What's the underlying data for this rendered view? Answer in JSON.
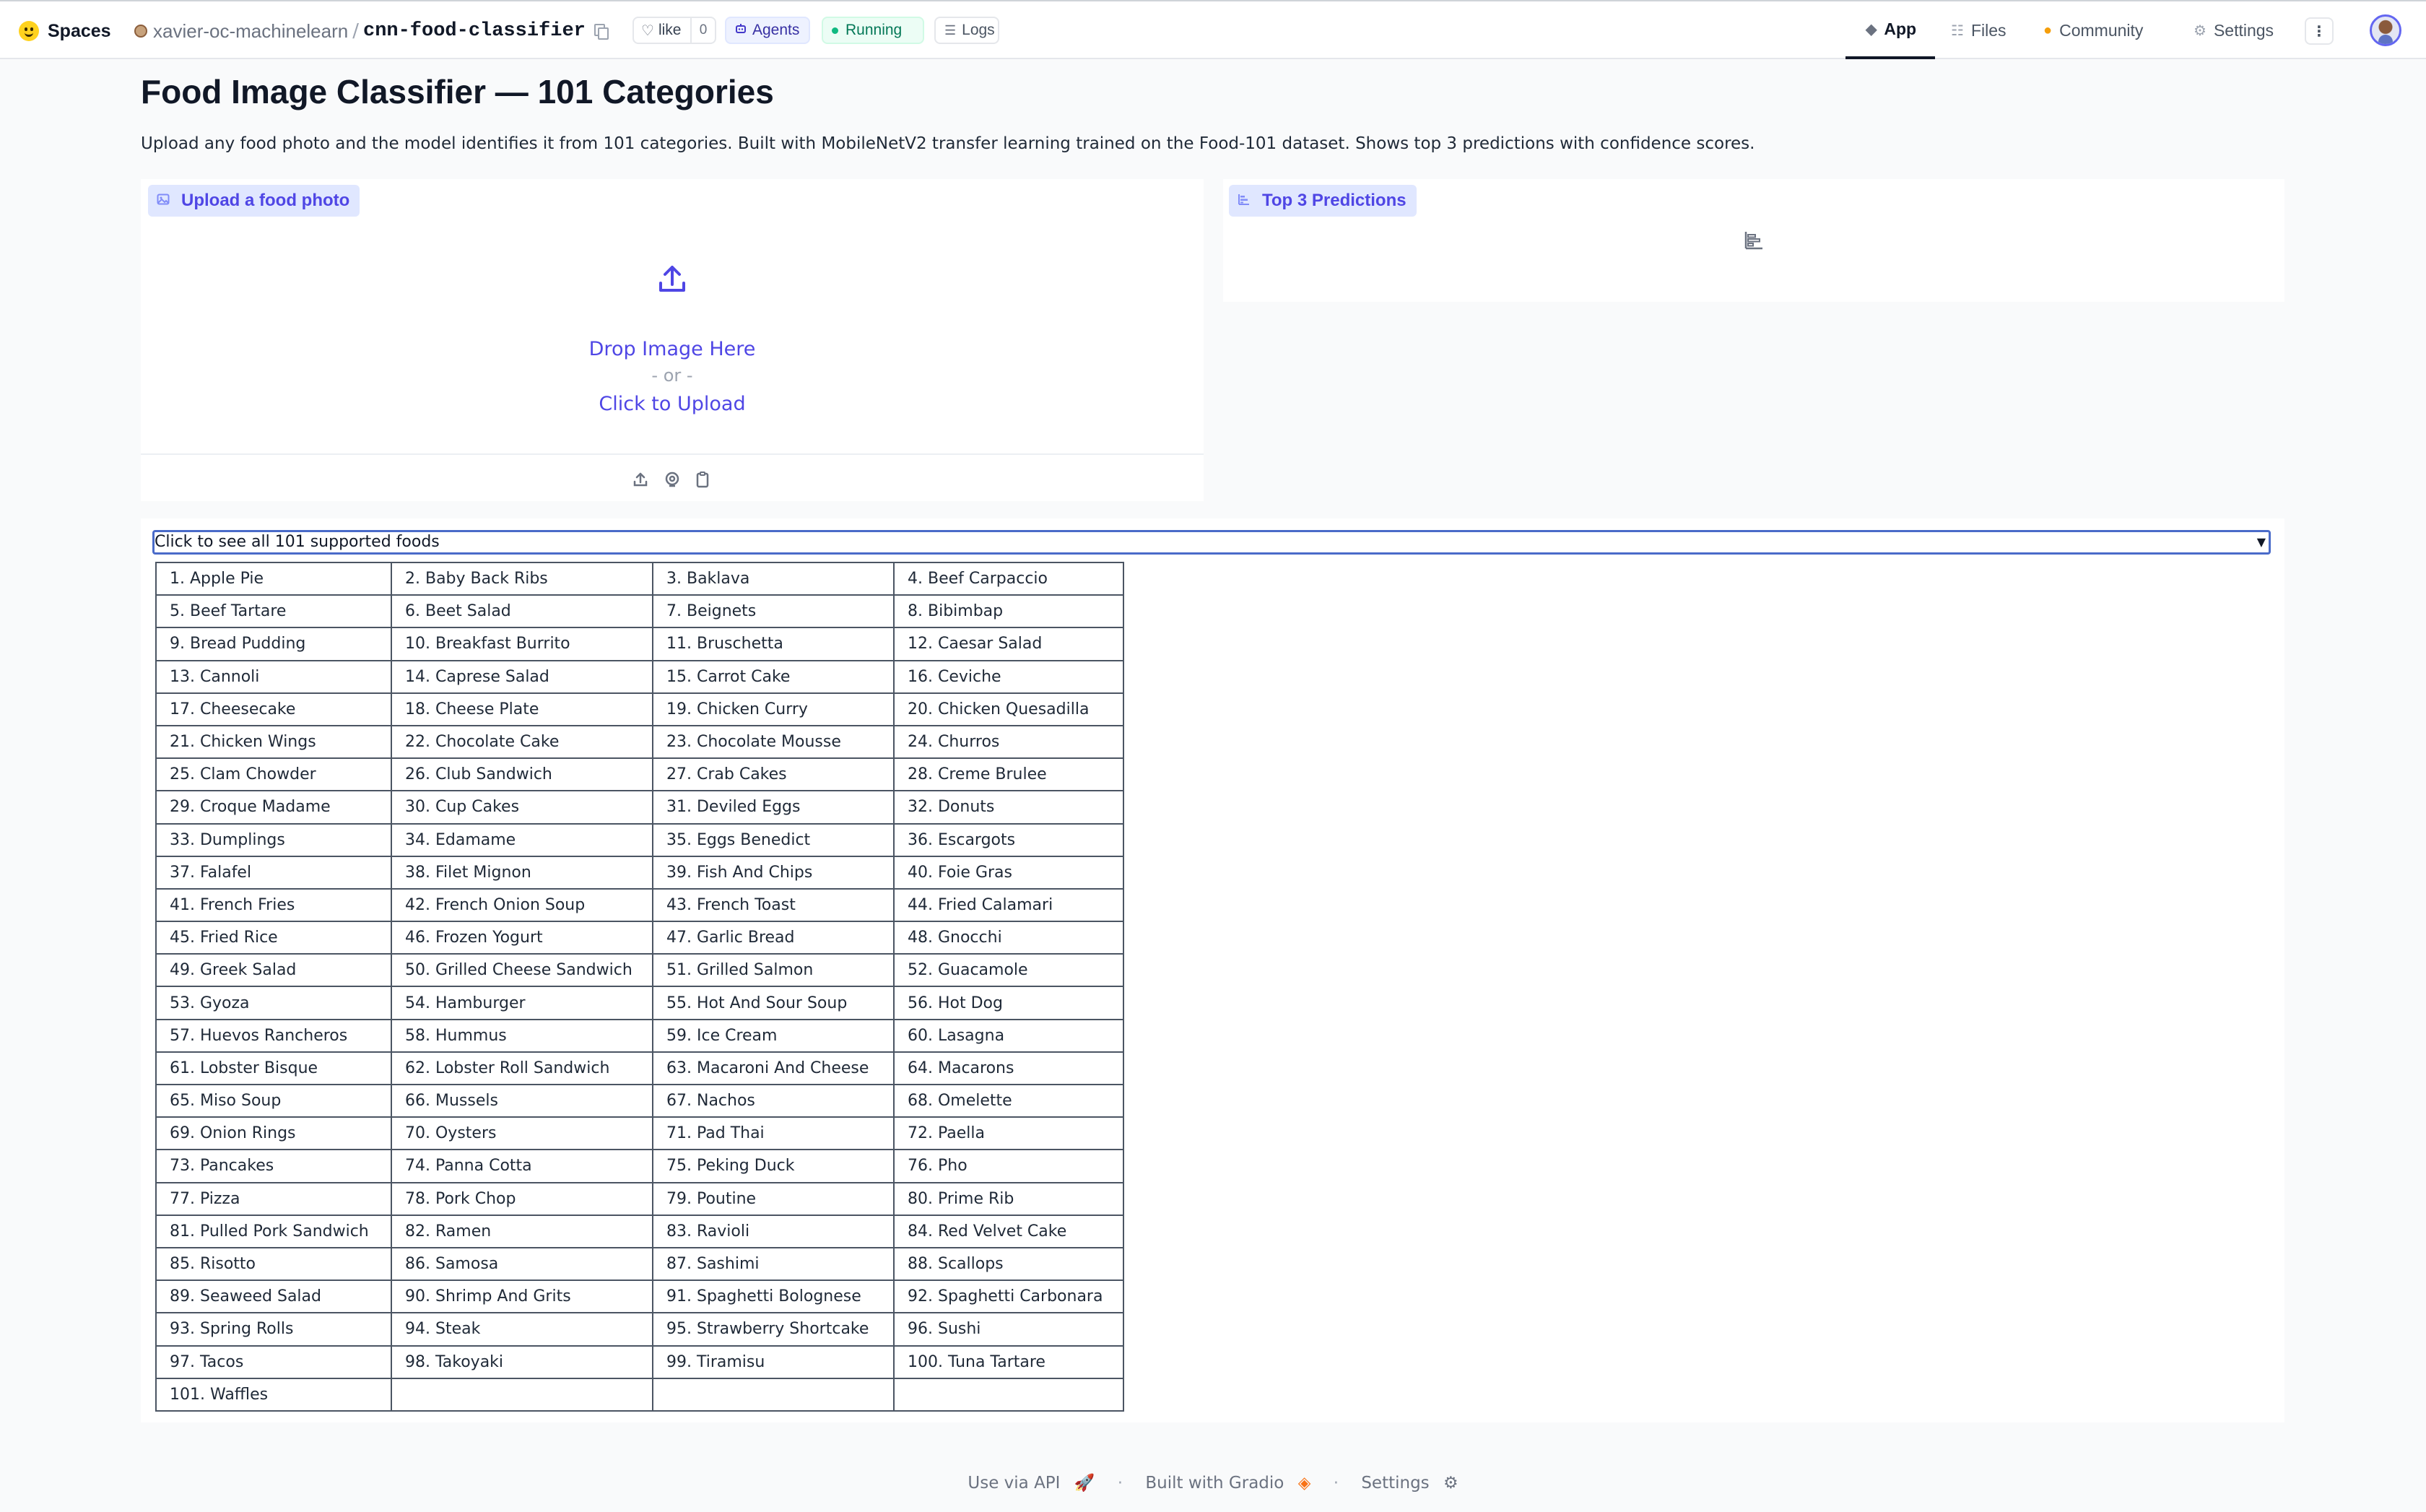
{
  "header": {
    "brand": "Spaces",
    "owner": "xavier-oc-machinelearn",
    "repo_name": "cnn-food-classifier",
    "like_label": "like",
    "like_count": "0",
    "agents_label": "Agents",
    "status_label": "Running",
    "logs_label": "Logs",
    "nav": {
      "app": "App",
      "files": "Files",
      "community": "Community",
      "settings": "Settings"
    }
  },
  "main": {
    "title": "Food Image Classifier — 101 Categories",
    "description": "Upload any food photo and the model identifies it from 101 categories. Built with MobileNetV2 transfer learning trained on the Food-101 dataset. Shows top 3 predictions with confidence scores.",
    "upload": {
      "label": "Upload a food photo",
      "drop_text": "Drop Image Here",
      "or_text": "- or -",
      "click_text": "Click to Upload"
    },
    "predictions": {
      "label": "Top 3 Predictions"
    },
    "foods_summary": "Click to see all 101 supported foods",
    "foods_rows": [
      [
        "1. Apple Pie",
        "2. Baby Back Ribs",
        "3. Baklava",
        "4. Beef Carpaccio"
      ],
      [
        "5. Beef Tartare",
        "6. Beet Salad",
        "7. Beignets",
        "8. Bibimbap"
      ],
      [
        "9. Bread Pudding",
        "10. Breakfast Burrito",
        "11. Bruschetta",
        "12. Caesar Salad"
      ],
      [
        "13. Cannoli",
        "14. Caprese Salad",
        "15. Carrot Cake",
        "16. Ceviche"
      ],
      [
        "17. Cheesecake",
        "18. Cheese Plate",
        "19. Chicken Curry",
        "20. Chicken Quesadilla"
      ],
      [
        "21. Chicken Wings",
        "22. Chocolate Cake",
        "23. Chocolate Mousse",
        "24. Churros"
      ],
      [
        "25. Clam Chowder",
        "26. Club Sandwich",
        "27. Crab Cakes",
        "28. Creme Brulee"
      ],
      [
        "29. Croque Madame",
        "30. Cup Cakes",
        "31. Deviled Eggs",
        "32. Donuts"
      ],
      [
        "33. Dumplings",
        "34. Edamame",
        "35. Eggs Benedict",
        "36. Escargots"
      ],
      [
        "37. Falafel",
        "38. Filet Mignon",
        "39. Fish And Chips",
        "40. Foie Gras"
      ],
      [
        "41. French Fries",
        "42. French Onion Soup",
        "43. French Toast",
        "44. Fried Calamari"
      ],
      [
        "45. Fried Rice",
        "46. Frozen Yogurt",
        "47. Garlic Bread",
        "48. Gnocchi"
      ],
      [
        "49. Greek Salad",
        "50. Grilled Cheese Sandwich",
        "51. Grilled Salmon",
        "52. Guacamole"
      ],
      [
        "53. Gyoza",
        "54. Hamburger",
        "55. Hot And Sour Soup",
        "56. Hot Dog"
      ],
      [
        "57. Huevos Rancheros",
        "58. Hummus",
        "59. Ice Cream",
        "60. Lasagna"
      ],
      [
        "61. Lobster Bisque",
        "62. Lobster Roll Sandwich",
        "63. Macaroni And Cheese",
        "64. Macarons"
      ],
      [
        "65. Miso Soup",
        "66. Mussels",
        "67. Nachos",
        "68. Omelette"
      ],
      [
        "69. Onion Rings",
        "70. Oysters",
        "71. Pad Thai",
        "72. Paella"
      ],
      [
        "73. Pancakes",
        "74. Panna Cotta",
        "75. Peking Duck",
        "76. Pho"
      ],
      [
        "77. Pizza",
        "78. Pork Chop",
        "79. Poutine",
        "80. Prime Rib"
      ],
      [
        "81. Pulled Pork Sandwich",
        "82. Ramen",
        "83. Ravioli",
        "84. Red Velvet Cake"
      ],
      [
        "85. Risotto",
        "86. Samosa",
        "87. Sashimi",
        "88. Scallops"
      ],
      [
        "89. Seaweed Salad",
        "90. Shrimp And Grits",
        "91. Spaghetti Bolognese",
        "92. Spaghetti Carbonara"
      ],
      [
        "93. Spring Rolls",
        "94. Steak",
        "95. Strawberry Shortcake",
        "96. Sushi"
      ],
      [
        "97. Tacos",
        "98. Takoyaki",
        "99. Tiramisu",
        "100. Tuna Tartare"
      ],
      [
        "101. Waffles",
        "",
        "",
        ""
      ]
    ]
  },
  "footer": {
    "api_label": "Use via API",
    "built_label": "Built with Gradio",
    "settings_label": "Settings"
  },
  "icons": {
    "brand": "hugging-face-icon",
    "copy": "copy-icon",
    "like": "heart-icon",
    "agents": "robot-icon",
    "logs": "logs-icon",
    "upload": "upload-arrow-icon",
    "webcam": "webcam-icon",
    "clipboard": "clipboard-icon",
    "chart": "bar-chart-icon"
  },
  "colors": {
    "accent": "#4f46e5",
    "label_bg": "#e0e7ff",
    "running_green": "#10b981",
    "summary_border": "#4a6bc9"
  }
}
